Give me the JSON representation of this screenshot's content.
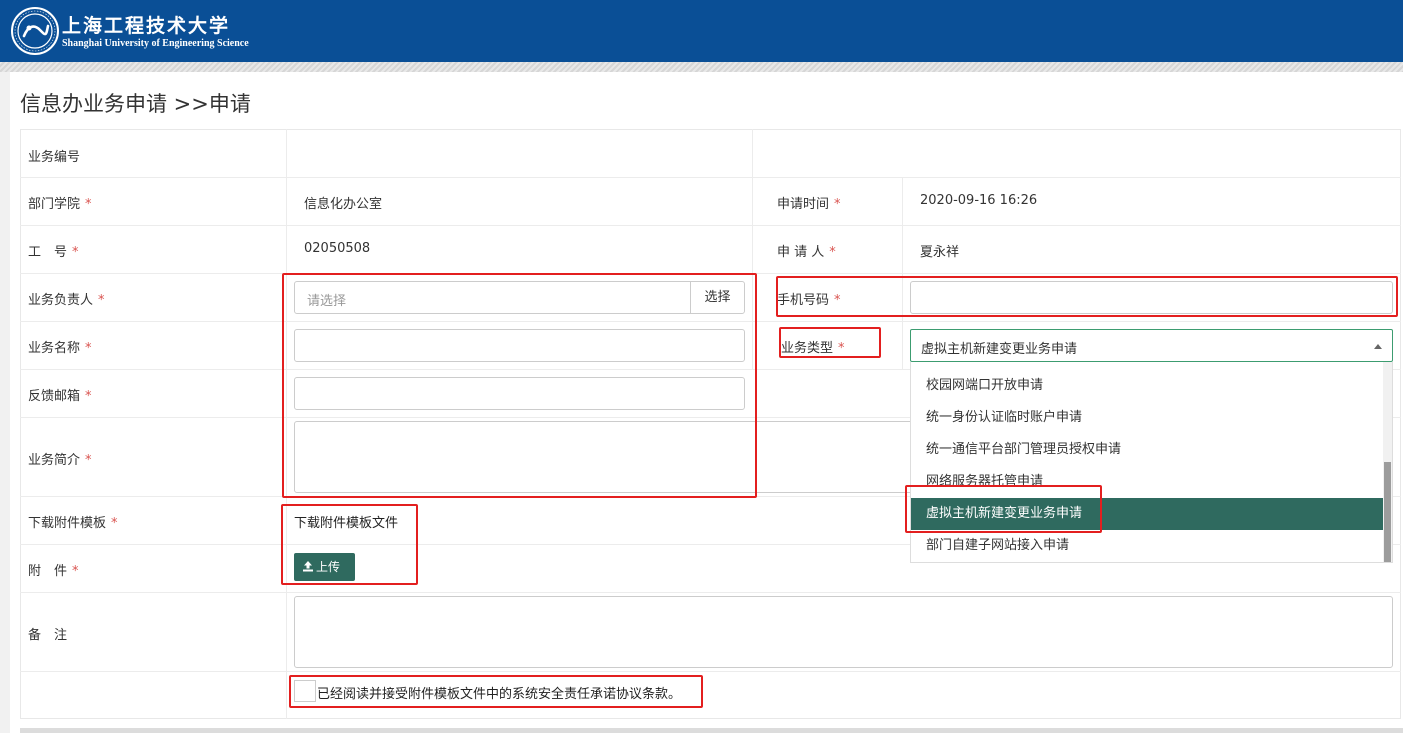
{
  "header": {
    "logo_cn": "上海工程技术大学",
    "logo_en": "Shanghai University of Engineering Science"
  },
  "page": {
    "title": "信息办业务申请 >>申请"
  },
  "form": {
    "required_mark": "*",
    "business_no": {
      "label": "业务编号",
      "value": ""
    },
    "department": {
      "label": "部门学院",
      "value": "信息化办公室"
    },
    "apply_time": {
      "label": "申请时间",
      "value": "2020-09-16 16:26"
    },
    "staff_no": {
      "label": "工　号",
      "value": "02050508"
    },
    "applicant": {
      "label": "申 请 人",
      "value": "夏永祥"
    },
    "owner": {
      "label": "业务负责人",
      "placeholder": "请选择",
      "button": "选择"
    },
    "phone": {
      "label": "手机号码",
      "value": ""
    },
    "business_name": {
      "label": "业务名称",
      "value": ""
    },
    "business_type": {
      "label": "业务类型",
      "value": "虚拟主机新建变更业务申请",
      "options": [
        "校园网端口开放申请",
        "统一身份认证临时账户申请",
        "统一通信平台部门管理员授权申请",
        "网络服务器托管申请",
        "虚拟主机新建变更业务申请",
        "部门自建子网站接入申请"
      ],
      "selected_index": 4
    },
    "email": {
      "label": "反馈邮箱",
      "value": ""
    },
    "summary": {
      "label": "业务简介",
      "value": ""
    },
    "template": {
      "label": "下载附件模板",
      "link": "下载附件模板文件"
    },
    "attachment": {
      "label": "附　件",
      "button": "上传"
    },
    "remark": {
      "label": "备　注",
      "value": ""
    },
    "agreement": {
      "text": "已经阅读并接受附件模板文件中的系统安全责任承诺协议条款。",
      "checked": false
    }
  },
  "colors": {
    "header_bg": "#0a4f96",
    "accent_green": "#2f6a5f",
    "required_red": "#d9534f",
    "highlight_red": "#e31f1f"
  }
}
